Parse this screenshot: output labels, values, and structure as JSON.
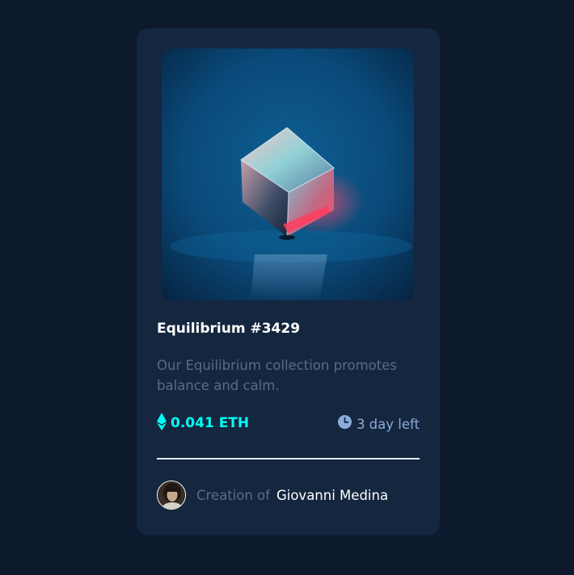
{
  "card": {
    "title": "Equilibrium #3429",
    "description": "Our Equilibrium collection promotes balance and calm.",
    "price": "0.041 ETH",
    "time_left": "3 day left",
    "creator_prefix": "Creation of",
    "creator_name": "Giovanni Medina"
  },
  "icons": {
    "price": "ethereum-icon",
    "time": "clock-icon",
    "image": "cube-image",
    "avatar": "avatar"
  },
  "colors": {
    "background": "#0d192c",
    "card": "#15263f",
    "accent_cyan": "#00fff8",
    "soft_blue": "#8bacd9",
    "muted_text": "#5d6b82",
    "white": "#ffffff"
  }
}
